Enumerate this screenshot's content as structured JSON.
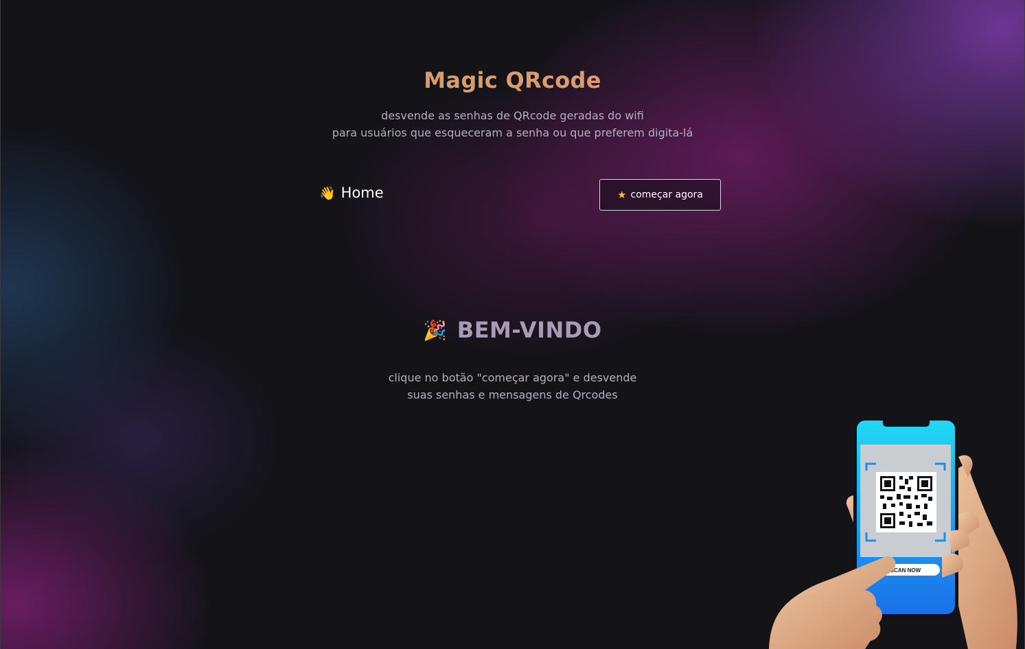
{
  "header": {
    "title": "Magic QRcode",
    "subtitle_line1": "desvende as senhas de QRcode geradas do wifi",
    "subtitle_line2": "para usuários que esqueceram a senha ou que preferem digita-lá"
  },
  "nav": {
    "home_emoji": "👋",
    "home_label": "Home",
    "start_icon": "★",
    "start_label": "começar agora"
  },
  "welcome": {
    "emoji": "🎉",
    "title": "BEM-VINDO",
    "text_line1": "clique no botão \"começar agora\" e desvende",
    "text_line2": "suas senhas e mensagens de Qrcodes"
  },
  "illustration": {
    "phone_button_label": "SCAN NOW"
  },
  "colors": {
    "title": "#d99c6e",
    "welcome_title": "#a89bb5",
    "body_text": "#b8aebf",
    "accent_purple": "#7d3caa",
    "accent_magenta": "#781e6e"
  }
}
